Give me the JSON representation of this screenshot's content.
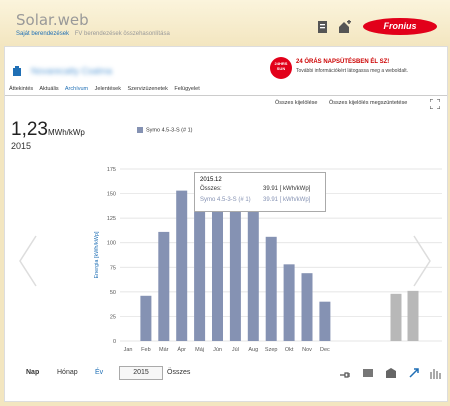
{
  "header": {
    "brand": "Solar.web",
    "nav": [
      "Saját berendezések",
      "FV berendezések összehasonlítása"
    ],
    "logo_text": "Fronius",
    "icons": [
      "report-icon",
      "add-system-icon"
    ]
  },
  "site": {
    "name": "Novarecatty Csalma"
  },
  "ad": {
    "badge": "24HRS SUN",
    "title": "24 ÓRÁS NAPSÜTÉSBEN ÉL SZ!",
    "text": "További információkért látogassa meg a weboldalt."
  },
  "tabs": [
    "Áttekintés",
    "Aktuális",
    "Archívum",
    "Jelentések",
    "Szervizüzenetek",
    "Felügyelet"
  ],
  "active_tab": "Archívum",
  "series_actions": {
    "select_all": "Összes kijelölése",
    "deselect_all": "Összes kijelölés megszüntetése"
  },
  "summary": {
    "value": "1,23",
    "unit": "MWh/kWp",
    "year": "2015"
  },
  "tooltip": {
    "date": "2015.12",
    "total_label": "Összes:",
    "total_value": "39.91 [ kWh/kWp]",
    "series_label": "Symo 4.5-3-S (# 1)",
    "series_value": "39.91 [ kWh/kWp]"
  },
  "bottom": {
    "periods": [
      "Nap",
      "Hónap",
      "Év",
      "Összes"
    ],
    "active_period": "Nap",
    "selected_year": "2015",
    "icons": [
      "plug-icon",
      "inverter-icon",
      "sensor-icon",
      "resize-icon",
      "bar-chart-icon"
    ]
  },
  "colors": {
    "bar": "#8592b3",
    "bar_muted": "#b8b8b8",
    "accent": "#1f6fb5",
    "brand_red": "#e2001a"
  },
  "chart_data": {
    "type": "bar",
    "ylabel": "Energia [kWh/kWp]",
    "ylim": [
      0,
      175
    ],
    "yticks": [
      0,
      25,
      50,
      75,
      100,
      125,
      150,
      175
    ],
    "categories": [
      "Jan",
      "Feb",
      "Már",
      "Ápr",
      "Máj",
      "Jún",
      "Júl",
      "Aug",
      "Szep",
      "Okt",
      "Nov",
      "Dec"
    ],
    "series": [
      {
        "name": "Symo 4.5-3-S (# 1)",
        "values": [
          0,
          46,
          111,
          153,
          151,
          161,
          161,
          160,
          106,
          78,
          69,
          40
        ]
      }
    ],
    "extra_bars": [
      48,
      51
    ],
    "grid": true,
    "legend": "top-left"
  }
}
